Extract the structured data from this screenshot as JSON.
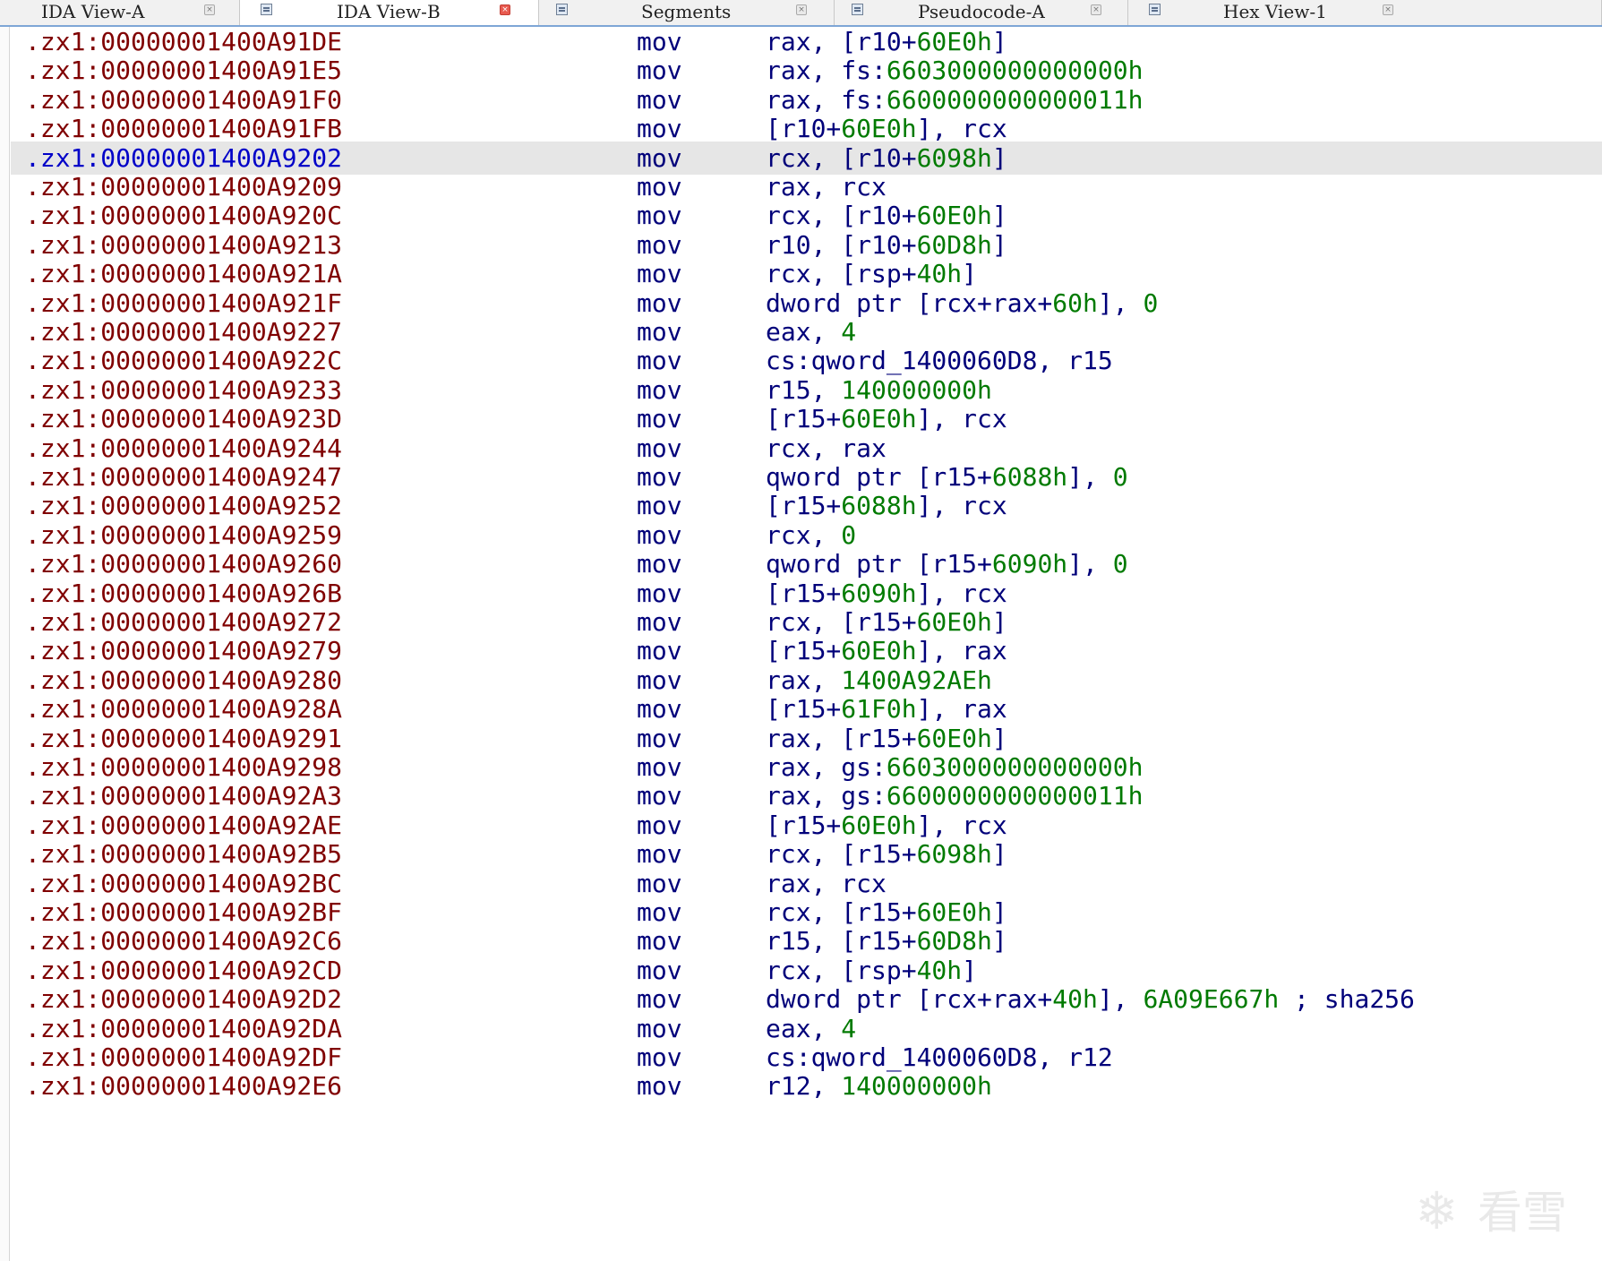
{
  "tabs": [
    {
      "label": "IDA View-A",
      "icon": "document-view-icon",
      "active": false
    },
    {
      "label": "IDA View-B",
      "icon": "document-view-icon",
      "active": true
    },
    {
      "label": "Segments",
      "icon": "segments-table-icon",
      "active": false
    },
    {
      "label": "Pseudocode-A",
      "icon": "pseudocode-icon",
      "active": false
    },
    {
      "label": "Hex View-1",
      "icon": "hex-view-icon",
      "active": false
    }
  ],
  "colors": {
    "address": "#800000",
    "address_selected": "#0000c8",
    "instruction": "#00007a",
    "immediate": "#007a00",
    "selected_row": "#e6e6e6"
  },
  "listing": {
    "rows": [
      {
        "addr": ".zx1:00000001400A91DE",
        "mnem": "mov",
        "ops": [
          [
            "rax, [r10+",
            0
          ],
          [
            "60E0h",
            1
          ],
          [
            "]",
            0
          ]
        ]
      },
      {
        "addr": ".zx1:00000001400A91E5",
        "mnem": "mov",
        "ops": [
          [
            "rax, fs:",
            0
          ],
          [
            "6603000000000000h",
            1
          ]
        ]
      },
      {
        "addr": ".zx1:00000001400A91F0",
        "mnem": "mov",
        "ops": [
          [
            "rax, fs:",
            0
          ],
          [
            "6600000000000011h",
            1
          ]
        ]
      },
      {
        "addr": ".zx1:00000001400A91FB",
        "mnem": "mov",
        "ops": [
          [
            "[r10+",
            0
          ],
          [
            "60E0h",
            1
          ],
          [
            "], rcx",
            0
          ]
        ]
      },
      {
        "addr": ".zx1:00000001400A9202",
        "mnem": "mov",
        "ops": [
          [
            "rcx, [r10+",
            0
          ],
          [
            "6098h",
            1
          ],
          [
            "]",
            0
          ]
        ],
        "selected": true
      },
      {
        "addr": ".zx1:00000001400A9209",
        "mnem": "mov",
        "ops": [
          [
            "rax, rcx",
            0
          ]
        ]
      },
      {
        "addr": ".zx1:00000001400A920C",
        "mnem": "mov",
        "ops": [
          [
            "rcx, [r10+",
            0
          ],
          [
            "60E0h",
            1
          ],
          [
            "]",
            0
          ]
        ]
      },
      {
        "addr": ".zx1:00000001400A9213",
        "mnem": "mov",
        "ops": [
          [
            "r10, [r10+",
            0
          ],
          [
            "60D8h",
            1
          ],
          [
            "]",
            0
          ]
        ]
      },
      {
        "addr": ".zx1:00000001400A921A",
        "mnem": "mov",
        "ops": [
          [
            "rcx, [rsp+",
            0
          ],
          [
            "40h",
            1
          ],
          [
            "]",
            0
          ]
        ]
      },
      {
        "addr": ".zx1:00000001400A921F",
        "mnem": "mov",
        "ops": [
          [
            "dword ptr [rcx+rax+",
            0
          ],
          [
            "60h",
            1
          ],
          [
            "], ",
            0
          ],
          [
            "0",
            1
          ]
        ]
      },
      {
        "addr": ".zx1:00000001400A9227",
        "mnem": "mov",
        "ops": [
          [
            "eax, ",
            0
          ],
          [
            "4",
            1
          ]
        ]
      },
      {
        "addr": ".zx1:00000001400A922C",
        "mnem": "mov",
        "ops": [
          [
            "cs:qword_1400060D8, r15",
            0
          ]
        ]
      },
      {
        "addr": ".zx1:00000001400A9233",
        "mnem": "mov",
        "ops": [
          [
            "r15, ",
            0
          ],
          [
            "140000000h",
            1
          ]
        ]
      },
      {
        "addr": ".zx1:00000001400A923D",
        "mnem": "mov",
        "ops": [
          [
            "[r15+",
            0
          ],
          [
            "60E0h",
            1
          ],
          [
            "], rcx",
            0
          ]
        ]
      },
      {
        "addr": ".zx1:00000001400A9244",
        "mnem": "mov",
        "ops": [
          [
            "rcx, rax",
            0
          ]
        ]
      },
      {
        "addr": ".zx1:00000001400A9247",
        "mnem": "mov",
        "ops": [
          [
            "qword ptr [r15+",
            0
          ],
          [
            "6088h",
            1
          ],
          [
            "], ",
            0
          ],
          [
            "0",
            1
          ]
        ]
      },
      {
        "addr": ".zx1:00000001400A9252",
        "mnem": "mov",
        "ops": [
          [
            "[r15+",
            0
          ],
          [
            "6088h",
            1
          ],
          [
            "], rcx",
            0
          ]
        ]
      },
      {
        "addr": ".zx1:00000001400A9259",
        "mnem": "mov",
        "ops": [
          [
            "rcx, ",
            0
          ],
          [
            "0",
            1
          ]
        ]
      },
      {
        "addr": ".zx1:00000001400A9260",
        "mnem": "mov",
        "ops": [
          [
            "qword ptr [r15+",
            0
          ],
          [
            "6090h",
            1
          ],
          [
            "], ",
            0
          ],
          [
            "0",
            1
          ]
        ]
      },
      {
        "addr": ".zx1:00000001400A926B",
        "mnem": "mov",
        "ops": [
          [
            "[r15+",
            0
          ],
          [
            "6090h",
            1
          ],
          [
            "], rcx",
            0
          ]
        ]
      },
      {
        "addr": ".zx1:00000001400A9272",
        "mnem": "mov",
        "ops": [
          [
            "rcx, [r15+",
            0
          ],
          [
            "60E0h",
            1
          ],
          [
            "]",
            0
          ]
        ]
      },
      {
        "addr": ".zx1:00000001400A9279",
        "mnem": "mov",
        "ops": [
          [
            "[r15+",
            0
          ],
          [
            "60E0h",
            1
          ],
          [
            "], rax",
            0
          ]
        ]
      },
      {
        "addr": ".zx1:00000001400A9280",
        "mnem": "mov",
        "ops": [
          [
            "rax, ",
            0
          ],
          [
            "1400A92AEh",
            1
          ]
        ]
      },
      {
        "addr": ".zx1:00000001400A928A",
        "mnem": "mov",
        "ops": [
          [
            "[r15+",
            0
          ],
          [
            "61F0h",
            1
          ],
          [
            "], rax",
            0
          ]
        ]
      },
      {
        "addr": ".zx1:00000001400A9291",
        "mnem": "mov",
        "ops": [
          [
            "rax, [r15+",
            0
          ],
          [
            "60E0h",
            1
          ],
          [
            "]",
            0
          ]
        ]
      },
      {
        "addr": ".zx1:00000001400A9298",
        "mnem": "mov",
        "ops": [
          [
            "rax, gs:",
            0
          ],
          [
            "6603000000000000h",
            1
          ]
        ]
      },
      {
        "addr": ".zx1:00000001400A92A3",
        "mnem": "mov",
        "ops": [
          [
            "rax, gs:",
            0
          ],
          [
            "6600000000000011h",
            1
          ]
        ]
      },
      {
        "addr": ".zx1:00000001400A92AE",
        "mnem": "mov",
        "ops": [
          [
            "[r15+",
            0
          ],
          [
            "60E0h",
            1
          ],
          [
            "], rcx",
            0
          ]
        ]
      },
      {
        "addr": ".zx1:00000001400A92B5",
        "mnem": "mov",
        "ops": [
          [
            "rcx, [r15+",
            0
          ],
          [
            "6098h",
            1
          ],
          [
            "]",
            0
          ]
        ]
      },
      {
        "addr": ".zx1:00000001400A92BC",
        "mnem": "mov",
        "ops": [
          [
            "rax, rcx",
            0
          ]
        ]
      },
      {
        "addr": ".zx1:00000001400A92BF",
        "mnem": "mov",
        "ops": [
          [
            "rcx, [r15+",
            0
          ],
          [
            "60E0h",
            1
          ],
          [
            "]",
            0
          ]
        ]
      },
      {
        "addr": ".zx1:00000001400A92C6",
        "mnem": "mov",
        "ops": [
          [
            "r15, [r15+",
            0
          ],
          [
            "60D8h",
            1
          ],
          [
            "]",
            0
          ]
        ]
      },
      {
        "addr": ".zx1:00000001400A92CD",
        "mnem": "mov",
        "ops": [
          [
            "rcx, [rsp+",
            0
          ],
          [
            "40h",
            1
          ],
          [
            "]",
            0
          ]
        ]
      },
      {
        "addr": ".zx1:00000001400A92D2",
        "mnem": "mov",
        "ops": [
          [
            "dword ptr [rcx+rax+",
            0
          ],
          [
            "40h",
            1
          ],
          [
            "], ",
            0
          ],
          [
            "6A09E667h",
            1
          ],
          [
            " ; sha256",
            2
          ]
        ]
      },
      {
        "addr": ".zx1:00000001400A92DA",
        "mnem": "mov",
        "ops": [
          [
            "eax, ",
            0
          ],
          [
            "4",
            1
          ]
        ]
      },
      {
        "addr": ".zx1:00000001400A92DF",
        "mnem": "mov",
        "ops": [
          [
            "cs:qword_1400060D8, r12",
            0
          ]
        ]
      },
      {
        "addr": ".zx1:00000001400A92E6",
        "mnem": "mov",
        "ops": [
          [
            "r12, ",
            0
          ],
          [
            "140000000h",
            1
          ]
        ]
      }
    ]
  },
  "watermark": {
    "logo": "snowflake-logo-icon",
    "text": "看雪"
  }
}
